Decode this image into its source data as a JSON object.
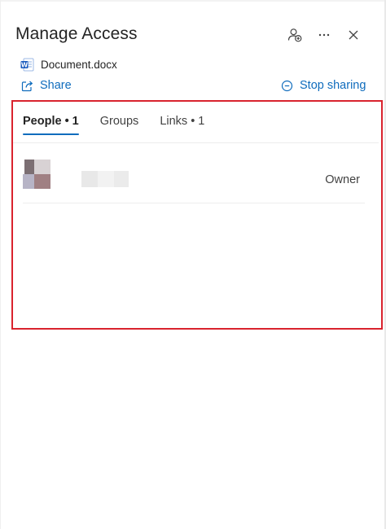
{
  "header": {
    "title": "Manage Access"
  },
  "file": {
    "name": "Document.docx",
    "icon": "word-document-icon",
    "icon_letter": "W",
    "icon_color": "#185abd"
  },
  "actions": {
    "share_label": "Share",
    "stop_sharing_label": "Stop sharing",
    "accent_color": "#0f6cbd"
  },
  "tabs": [
    {
      "label": "People • 1",
      "active": true
    },
    {
      "label": "Groups",
      "active": false
    },
    {
      "label": "Links • 1",
      "active": false
    }
  ],
  "people": [
    {
      "role": "Owner"
    }
  ],
  "highlight_color": "#d9232e"
}
